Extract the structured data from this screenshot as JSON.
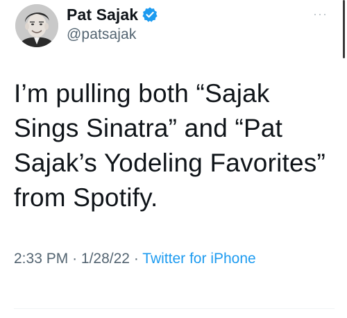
{
  "author": {
    "display_name": "Pat Sajak",
    "handle": "@patsajak",
    "verified_icon": "verified-badge-icon"
  },
  "tweet": {
    "text": "I’m pulling both “Sajak Sings Sinatra” and “Pat Sajak’s Yodeling Favorites” from Spotify."
  },
  "meta": {
    "time": "2:33 PM",
    "separator": "·",
    "date": "1/28/22",
    "source": "Twitter for iPhone"
  },
  "menu": {
    "more_label": "···"
  },
  "colors": {
    "text": "#0f1419",
    "secondary": "#536471",
    "accent": "#1d9bf0"
  }
}
